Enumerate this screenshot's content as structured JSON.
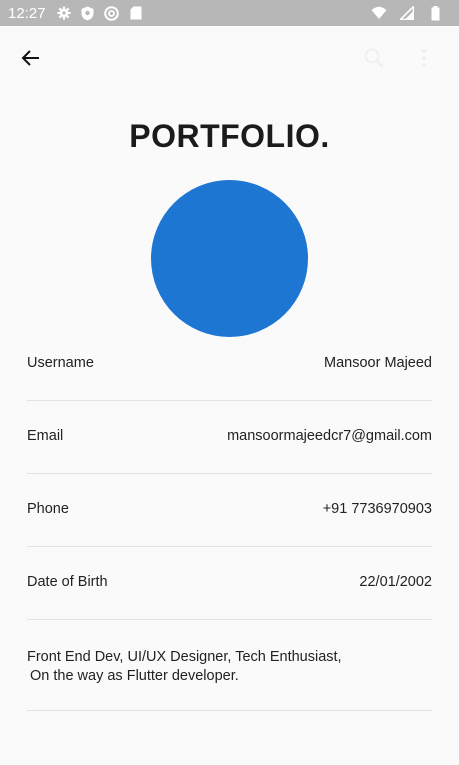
{
  "status_bar": {
    "time": "12:27",
    "left_icons": [
      "gear-icon",
      "shield-icon",
      "at-sign-icon",
      "sd-card-icon"
    ],
    "right_icons": [
      "wifi-icon",
      "signal-icon",
      "battery-icon"
    ]
  },
  "app_bar": {
    "back_icon": "arrow-left-icon",
    "actions": [
      "search-icon",
      "more-vert-icon"
    ]
  },
  "profile": {
    "title": "PORTFOLIO.",
    "avatar_color": "#1d76d2",
    "fields": [
      {
        "label": "Username",
        "value": "Mansoor Majeed"
      },
      {
        "label": "Email",
        "value": "mansoormajeedcr7@gmail.com"
      },
      {
        "label": "Phone",
        "value": "+91 7736970903"
      },
      {
        "label": "Date of Birth",
        "value": "22/01/2002"
      }
    ],
    "bio_lines": [
      "Front End Dev, UI/UX Designer, Tech Enthusiast,",
      "On the way as Flutter developer."
    ]
  },
  "colors": {
    "status_bar_bg": "#b7b7b7",
    "background": "#fafafa",
    "divider": "#e2e2e2",
    "text": "#222222"
  }
}
